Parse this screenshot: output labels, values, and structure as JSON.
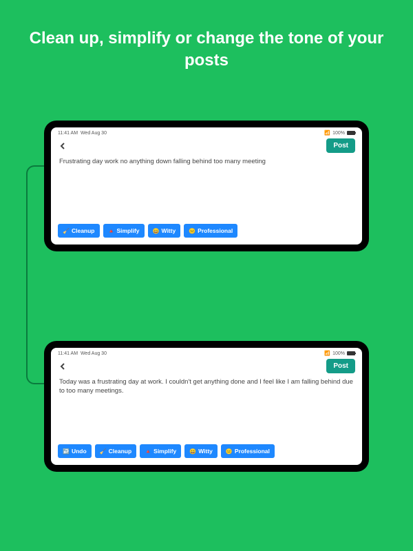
{
  "headline": "Clean up, simplify or change the tone of your posts",
  "statusbar": {
    "time": "11:41 AM",
    "date": "Wed Aug 30",
    "battery": "100%"
  },
  "post_button_label": "Post",
  "screen1": {
    "text": "Frustrating day work no anything down falling behind too many meeting",
    "actions": [
      {
        "emoji": "🧹",
        "label": "Cleanup"
      },
      {
        "emoji": "🔺",
        "label": "Simplify"
      },
      {
        "emoji": "😄",
        "label": "Witty"
      },
      {
        "emoji": "😐",
        "label": "Professional"
      }
    ]
  },
  "screen2": {
    "text": "Today was a frustrating day at work. I couldn't get anything done and I feel like I am falling behind due to too many meetings.",
    "actions": [
      {
        "emoji": "↩️",
        "label": "Undo"
      },
      {
        "emoji": "🧹",
        "label": "Cleanup"
      },
      {
        "emoji": "🔺",
        "label": "Simplify"
      },
      {
        "emoji": "😄",
        "label": "Witty"
      },
      {
        "emoji": "😐",
        "label": "Professional"
      }
    ]
  }
}
